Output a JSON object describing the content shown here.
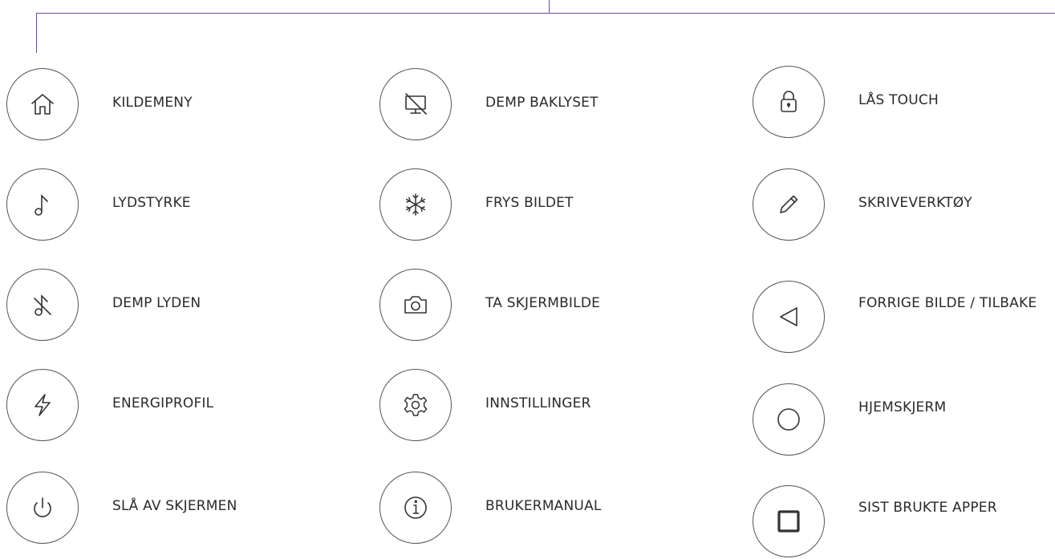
{
  "accent_color": "#6b4aa0",
  "columns": [
    {
      "items": [
        {
          "label": "KILDEMENY",
          "icon": "home-icon"
        },
        {
          "label": "LYDSTYRKE",
          "icon": "music-note-icon"
        },
        {
          "label": "DEMP LYDEN",
          "icon": "mute-note-icon"
        },
        {
          "label": "ENERGIPROFIL",
          "icon": "lightning-icon"
        },
        {
          "label": "SLÅ AV SKJERMEN",
          "icon": "power-icon"
        }
      ]
    },
    {
      "items": [
        {
          "label": "DEMP BAKLYSET",
          "icon": "monitor-off-icon"
        },
        {
          "label": "FRYS BILDET",
          "icon": "snowflake-icon"
        },
        {
          "label": "TA SKJERMBILDE",
          "icon": "camera-icon"
        },
        {
          "label": "INNSTILLINGER",
          "icon": "gear-icon"
        },
        {
          "label": "BRUKERMANUAL",
          "icon": "info-icon"
        }
      ]
    },
    {
      "items": [
        {
          "label": "LÅS TOUCH",
          "icon": "lock-icon"
        },
        {
          "label": "SKRIVEVERKTØY",
          "icon": "pencil-icon"
        },
        {
          "label": "FORRIGE BILDE / TILBAKE",
          "icon": "back-triangle-icon"
        },
        {
          "label": "HJEMSKJERM",
          "icon": "home-circle-icon"
        },
        {
          "label": "SIST BRUKTE APPER",
          "icon": "recent-apps-square-icon"
        }
      ]
    }
  ]
}
